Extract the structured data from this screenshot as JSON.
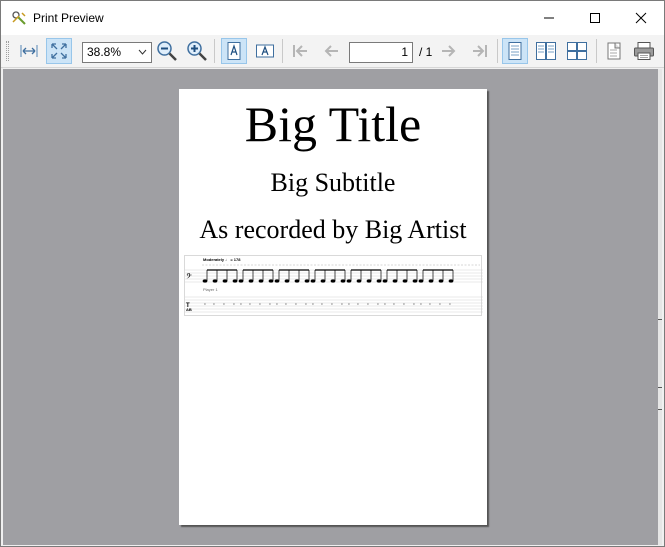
{
  "window": {
    "title": "Print Preview"
  },
  "toolbar": {
    "zoom_value": "38.8%",
    "page_current": "1",
    "page_total": "/ 1",
    "icons": [
      "fit-width-icon",
      "fit-page-icon",
      "zoom-out-icon",
      "zoom-in-icon",
      "portrait-icon",
      "landscape-icon",
      "first-page-icon",
      "previous-page-icon",
      "next-page-icon",
      "last-page-icon",
      "single-page-icon",
      "facing-pages-icon",
      "overview-icon",
      "page-setup-icon",
      "print-icon"
    ]
  },
  "page": {
    "title": "Big Title",
    "subtitle": "Big Subtitle",
    "artist": "As recorded by Big Artist",
    "tempo_text": "Moderately",
    "tempo_value": "= 178",
    "player": "Player 1"
  }
}
